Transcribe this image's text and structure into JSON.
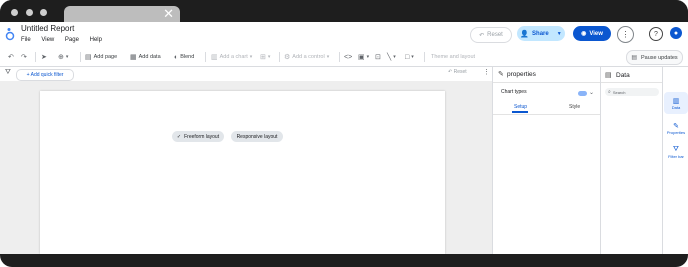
{
  "header": {
    "title": "Untitled Report",
    "menus": [
      "File",
      "View",
      "Page",
      "Help"
    ],
    "reset_label": "Reset",
    "share_label": "Share",
    "view_label": "View"
  },
  "toolbar": {
    "add_page": "Add page",
    "add_data": "Add data",
    "blend": "Blend",
    "add_chart": "Add a chart",
    "add_control": "Add a control",
    "theme_layout": "Theme and layout",
    "pause_updates": "Pause updates"
  },
  "filterbar": {
    "quick_filter": "+ Add quick filter",
    "reset_label": "Reset"
  },
  "canvas": {
    "freeform_label": "Freeform layout",
    "responsive_label": "Responsive layout"
  },
  "properties": {
    "title": "properties",
    "chart_types": "Chart types",
    "tabs": [
      "Setup",
      "Style"
    ]
  },
  "data_panel": {
    "title": "Data",
    "search_placeholder": "Search"
  },
  "rail": {
    "items": [
      "Data",
      "Properties",
      "Filter bar"
    ]
  },
  "colors": {
    "accent": "#0b57d0",
    "share_bg": "#c2e7ff"
  }
}
